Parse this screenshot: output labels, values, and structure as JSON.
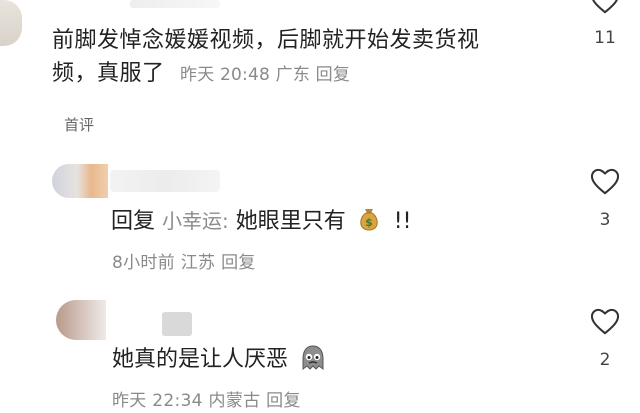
{
  "top_comment": {
    "text_line1": "前脚发悼念媛媛视频，后脚就开始发卖货视",
    "text_line2": "频，真服了",
    "time": "昨天 20:48",
    "location": "广东",
    "reply_label": "回复",
    "like_count": "11"
  },
  "section_tag": "首评",
  "replies": [
    {
      "prefix": "回复",
      "mention": "小幸运:",
      "text": "她眼里只有",
      "emoji_name": "money-bag-icon",
      "suffix": "!!",
      "time": "8小时前",
      "location": "江苏",
      "reply_label": "回复",
      "like_count": "3"
    },
    {
      "text": "她真的是让人厌恶",
      "emoji_name": "ghost-emoji-icon",
      "time": "昨天 22:34",
      "location": "内蒙古",
      "reply_label": "回复",
      "like_count": "2"
    }
  ],
  "colors": {
    "text": "#222222",
    "meta": "#8a8a8a",
    "background": "#ffffff"
  }
}
